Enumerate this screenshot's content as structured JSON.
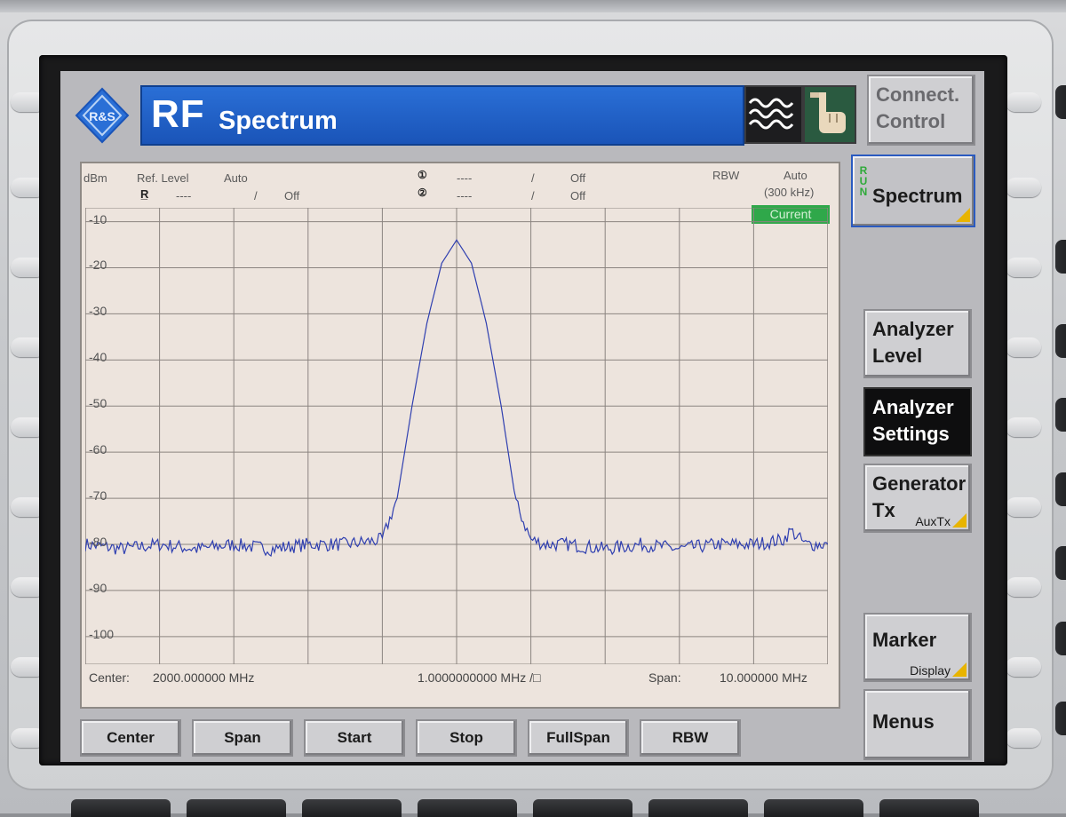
{
  "title": {
    "rf": "RF",
    "name": "Spectrum"
  },
  "right_softkeys": {
    "connect": "Connect.\nControl",
    "spectrum": "Spectrum",
    "run_letters": [
      "R",
      "U",
      "N"
    ],
    "analyzer_level": "Analyzer\nLevel",
    "analyzer_settings": "Analyzer\nSettings",
    "generator": "Generator",
    "generator_tx": "Tx",
    "generator_sub": "AuxTx",
    "marker": "Marker",
    "marker_sub": "Display",
    "menus": "Menus"
  },
  "bottom_softkeys": [
    "Center",
    "Span",
    "Start",
    "Stop",
    "FullSpan",
    "RBW"
  ],
  "header": {
    "unit": "dBm",
    "ref_level_label": "Ref. Level",
    "ref_level_mode": "Auto",
    "ref_dash": "----",
    "slash1": "/",
    "off1": "Off",
    "m1_dash": "----",
    "m1_slash": "/",
    "m1_off": "Off",
    "m2_dash": "----",
    "m2_slash": "/",
    "m2_off": "Off",
    "rbw_label": "RBW",
    "rbw_mode": "Auto",
    "rbw_value": "(300 kHz)",
    "current_badge": "Current"
  },
  "footer": {
    "center_label": "Center:",
    "center_value": "2000.000000  MHz",
    "div_value": "1.0000000000 MHz  /□",
    "span_label": "Span:",
    "span_value": "10.000000  MHz"
  },
  "colors": {
    "trace": "#2f3fb0",
    "grid": "#8b8480",
    "plot_bg": "#ede4dd",
    "title_blue": "#1f5fc6",
    "current_green": "#2fa84a"
  },
  "chart_data": {
    "type": "line",
    "title": "",
    "xlabel": "",
    "ylabel": "dBm",
    "y_tick_labels": [
      "-10",
      "-20",
      "-30",
      "-40",
      "-50",
      "-60",
      "-70",
      "-80",
      "-90",
      "-100"
    ],
    "ylim": [
      -106,
      -7
    ],
    "xlim": [
      1995,
      2005
    ],
    "x_unit": "MHz",
    "grid": true,
    "series": [
      {
        "x": [
          1995.0,
          1995.5,
          1996.0,
          1996.5,
          1997.0,
          1997.5,
          1998.0,
          1998.5,
          1999.0,
          1999.2,
          1999.4,
          1999.6,
          1999.8,
          2000.0,
          2000.2,
          2000.4,
          2000.6,
          2000.8,
          2001.0,
          2001.2,
          2001.5,
          2002.0,
          2002.5,
          2003.0,
          2003.5,
          2004.0,
          2004.4,
          2004.5,
          2004.7,
          2005.0
        ],
        "y": [
          -80,
          -81,
          -80,
          -81,
          -80,
          -81,
          -80,
          -80,
          -79,
          -70,
          -50,
          -32,
          -19,
          -14,
          -19,
          -32,
          -50,
          -71,
          -79,
          -80,
          -80,
          -81,
          -80,
          -81,
          -80,
          -80,
          -79,
          -77,
          -80,
          -80
        ]
      }
    ]
  }
}
